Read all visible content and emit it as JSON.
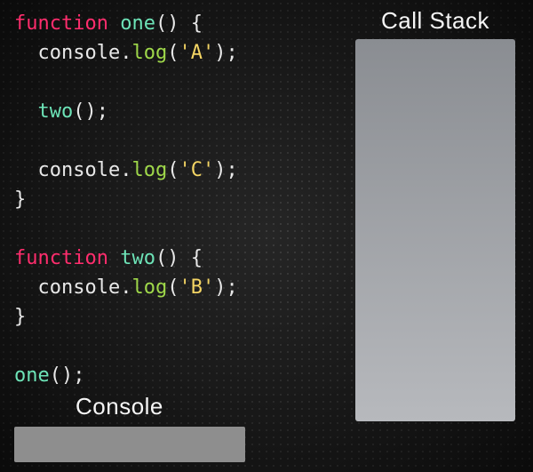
{
  "code": {
    "lines": [
      [
        [
          "kw",
          "function"
        ],
        [
          "pn",
          " "
        ],
        [
          "fn",
          "one"
        ],
        [
          "pn",
          "() {"
        ]
      ],
      [
        [
          "pn",
          "  "
        ],
        [
          "ob",
          "console"
        ],
        [
          "pn",
          "."
        ],
        [
          "mt",
          "log"
        ],
        [
          "pn",
          "("
        ],
        [
          "st",
          "'A'"
        ],
        [
          "pn",
          ");"
        ]
      ],
      [],
      [
        [
          "pn",
          "  "
        ],
        [
          "fn",
          "two"
        ],
        [
          "pn",
          "();"
        ]
      ],
      [],
      [
        [
          "pn",
          "  "
        ],
        [
          "ob",
          "console"
        ],
        [
          "pn",
          "."
        ],
        [
          "mt",
          "log"
        ],
        [
          "pn",
          "("
        ],
        [
          "st",
          "'C'"
        ],
        [
          "pn",
          ");"
        ]
      ],
      [
        [
          "pn",
          "}"
        ]
      ],
      [],
      [
        [
          "kw",
          "function"
        ],
        [
          "pn",
          " "
        ],
        [
          "fn",
          "two"
        ],
        [
          "pn",
          "() {"
        ]
      ],
      [
        [
          "pn",
          "  "
        ],
        [
          "ob",
          "console"
        ],
        [
          "pn",
          "."
        ],
        [
          "mt",
          "log"
        ],
        [
          "pn",
          "("
        ],
        [
          "st",
          "'B'"
        ],
        [
          "pn",
          ");"
        ]
      ],
      [
        [
          "pn",
          "}"
        ]
      ],
      [],
      [
        [
          "fn",
          "one"
        ],
        [
          "pn",
          "();"
        ]
      ]
    ]
  },
  "labels": {
    "callStack": "Call Stack",
    "console": "Console"
  },
  "callStack": [],
  "consoleOutput": []
}
